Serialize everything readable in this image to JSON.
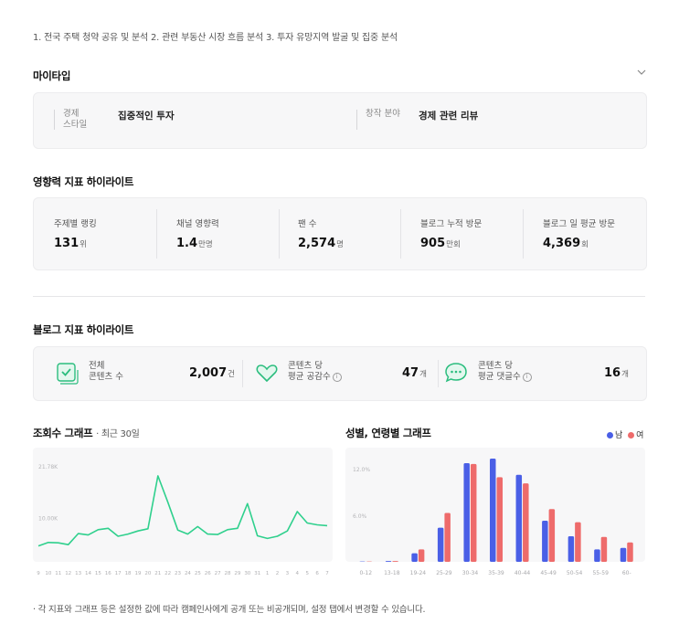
{
  "intro_text": "1. 전국 주택 청약 공유 및 분석 2. 관련 부동산 시장 흐름 분석 3. 투자 유망지역 발굴 및 집중 분석",
  "mytype": {
    "title": "마이타입",
    "style_label_line1": "경제",
    "style_label_line2": "스타일",
    "style_value": "집중적인 투자",
    "field_label": "창작 분야",
    "field_value": "경제 관련 리뷰"
  },
  "influence": {
    "title": "영향력 지표 하이라이트",
    "stats": [
      {
        "label": "주제별 랭킹",
        "value": "131",
        "unit": "위"
      },
      {
        "label": "채널 영향력",
        "value": "1.4",
        "unit": "만명"
      },
      {
        "label": "팬 수",
        "value": "2,574",
        "unit": "명"
      },
      {
        "label": "블로그 누적 방문",
        "value": "905",
        "unit": "만회"
      },
      {
        "label": "블로그 일 평균 방문",
        "value": "4,369",
        "unit": "회"
      }
    ]
  },
  "blog": {
    "title": "블로그 지표 하이라이트",
    "items": [
      {
        "label1": "전체",
        "label2": "콘텐츠 수",
        "value": "2,007",
        "unit": "건",
        "icon": "checkbox-icon"
      },
      {
        "label1": "콘텐츠 당",
        "label2": "평균 공감수",
        "value": "47",
        "unit": "개",
        "icon": "heart-icon",
        "info": "i"
      },
      {
        "label1": "콘텐츠 당",
        "label2": "평균 댓글수",
        "value": "16",
        "unit": "개",
        "icon": "chat-icon",
        "info": "i"
      }
    ]
  },
  "views_chart": {
    "title": "조회수 그래프",
    "subtitle": "· 최근 30일"
  },
  "demo_chart": {
    "title": "성별, 연령별 그래프",
    "legend_male": "남",
    "legend_female": "여"
  },
  "colors": {
    "line": "#2fd08d",
    "male": "#4a5fe6",
    "female": "#ee6b6b",
    "icon_green": "#2bbd7e"
  },
  "chart_data": [
    {
      "type": "line",
      "title": "조회수 그래프",
      "subtitle": "최근 30일",
      "x": [
        "9",
        "10",
        "11",
        "12",
        "13",
        "14",
        "15",
        "16",
        "17",
        "18",
        "19",
        "20",
        "21",
        "22",
        "23",
        "24",
        "25",
        "26",
        "27",
        "28",
        "29",
        "30",
        "31",
        "1",
        "2",
        "3",
        "4",
        "5",
        "6",
        "7"
      ],
      "values": [
        3600,
        4400,
        4300,
        3900,
        6400,
        6100,
        7300,
        7600,
        5800,
        6300,
        7000,
        7500,
        19500,
        13500,
        7200,
        6300,
        8000,
        6300,
        6200,
        7300,
        7600,
        13200,
        5900,
        5300,
        5800,
        7000,
        11400,
        8800,
        8400,
        8200
      ],
      "y_ticks": [
        "10.00K",
        "21.78K"
      ],
      "ylim": [
        0,
        23000
      ]
    },
    {
      "type": "bar",
      "title": "성별, 연령별 그래프",
      "categories": [
        "0-12",
        "13-18",
        "19-24",
        "25-29",
        "30-34",
        "35-39",
        "40-44",
        "45-49",
        "50-54",
        "55-59",
        "60-"
      ],
      "series": [
        {
          "name": "남",
          "values": [
            0.05,
            0.1,
            1.1,
            4.4,
            12.7,
            13.3,
            11.2,
            5.3,
            3.3,
            1.6,
            1.8
          ]
        },
        {
          "name": "여",
          "values": [
            0.05,
            0.1,
            1.6,
            6.3,
            12.6,
            10.9,
            10.1,
            6.8,
            5.1,
            3.2,
            2.5
          ]
        }
      ],
      "y_ticks": [
        "6.0%",
        "12.0%"
      ],
      "ylim": [
        0,
        14
      ],
      "legend": "top-right"
    }
  ],
  "footnote": "· 각 지표와 그래프 등은 설정한 값에 따라 캠페인사에게 공개 또는 비공개되며, 설정 탭에서 변경할 수 있습니다."
}
